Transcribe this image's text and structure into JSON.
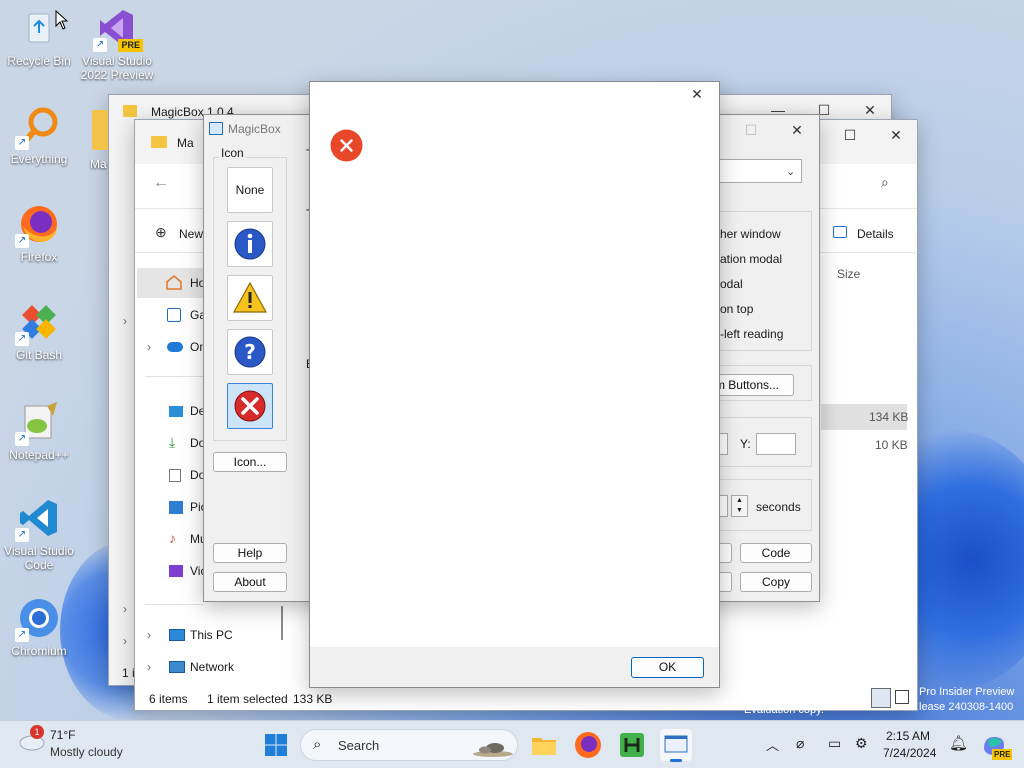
{
  "desktop": {
    "icons": [
      {
        "label": "Recycle Bin"
      },
      {
        "label": "Visual Studio 2022 Preview",
        "badge": "PRE"
      },
      {
        "label": "Everything"
      },
      {
        "label": "Firefox"
      },
      {
        "label": "Git Bash"
      },
      {
        "label": "Notepad++"
      },
      {
        "label": "Visual Studio Code"
      },
      {
        "label": "Chromium"
      }
    ],
    "watermark_line1": "Pro Insider Preview",
    "watermark_line2": "lease 240308-1400",
    "eval_text": "Evaluation copy."
  },
  "explorer_back": {
    "title": "MagicBox 1.0.4",
    "partial_label": "Ma"
  },
  "explorer": {
    "title": "Ma",
    "new_label": "New",
    "details_label": "Details",
    "size_header": "Size",
    "sizes": [
      "134 KB",
      "10 KB"
    ],
    "nav": [
      "Ho",
      "Ga",
      "On",
      "De",
      "Do",
      "Do",
      "Pic",
      "Mu",
      "Vic"
    ],
    "this_pc": "This PC",
    "network": "Network",
    "status_items": "6 items",
    "status_selected": "1 item selected",
    "status_size": "133 KB",
    "partial_i": "1 i"
  },
  "magicbox": {
    "title": "MagicBox",
    "icon_group": "Icon",
    "icon_none": "None",
    "icon_browse": "Icon...",
    "help": "Help",
    "about": "About",
    "options": [
      "her window",
      "ation modal",
      "odal",
      "on top",
      "-left reading"
    ],
    "custom_buttons": "m Buttons...",
    "y_label": "Y:",
    "seconds": "seconds",
    "code": "Code",
    "copy": "Copy",
    "col_t": "T",
    "col_b": "B"
  },
  "dialog": {
    "ok": "OK",
    "error_color": "#e8472a"
  },
  "taskbar": {
    "weather_temp": "71°F",
    "weather_desc": "Mostly cloudy",
    "weather_badge": "1",
    "search_placeholder": "Search",
    "time": "2:15 AM",
    "date": "7/24/2024",
    "copilot_badge": "PRE"
  }
}
